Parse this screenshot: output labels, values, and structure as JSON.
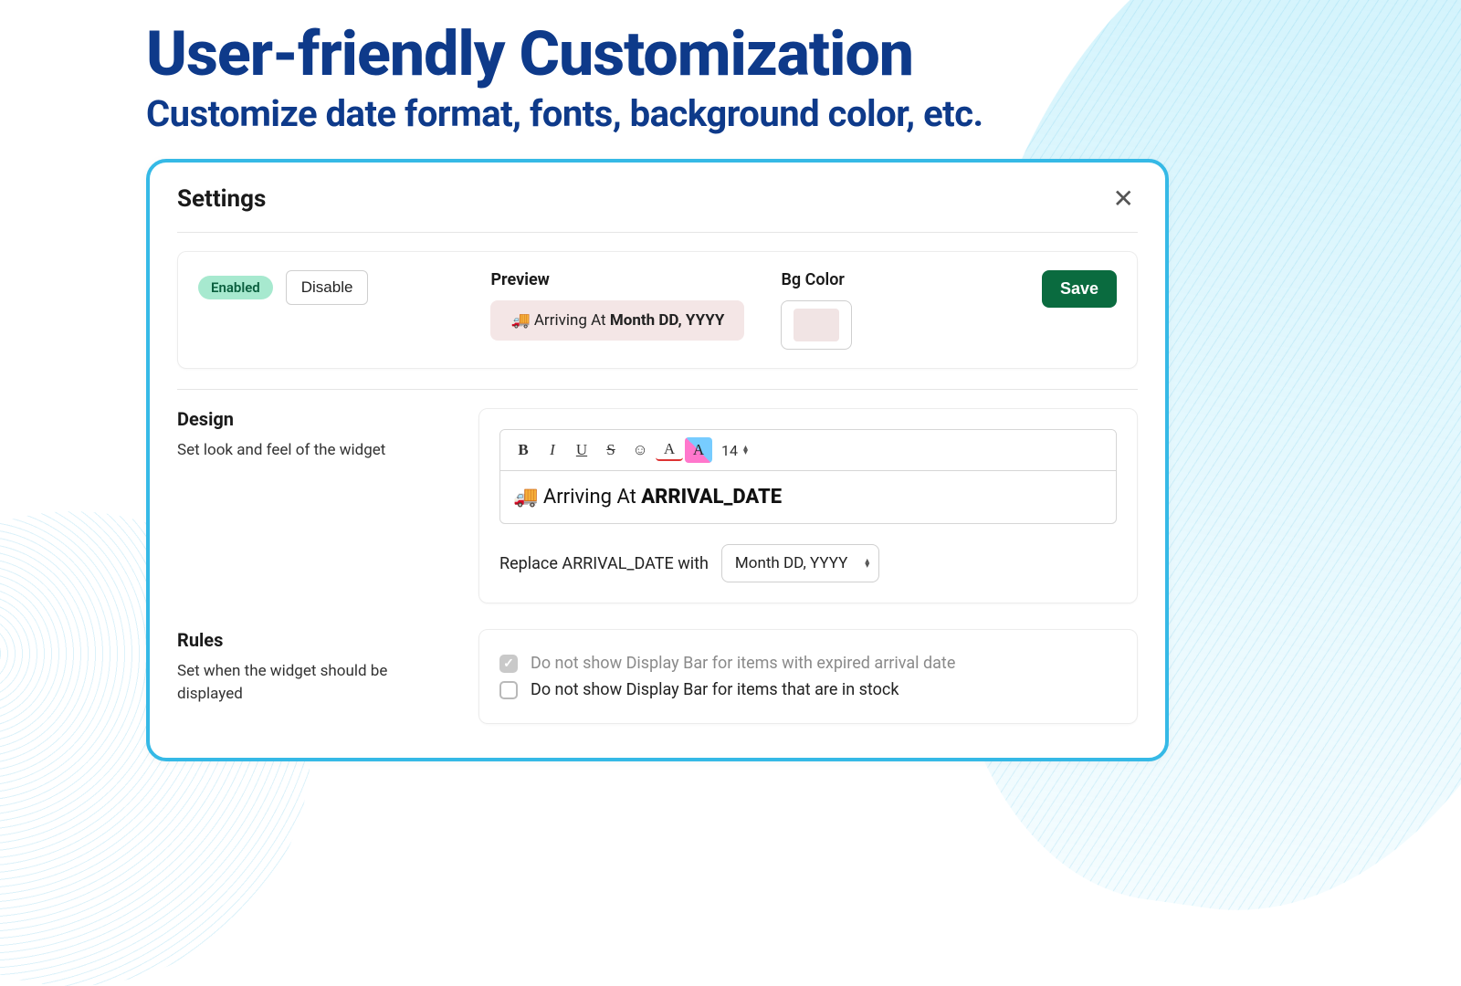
{
  "hero": {
    "title": "User-friendly Customization",
    "subtitle": "Customize date format, fonts, background color, etc."
  },
  "modal": {
    "title": "Settings",
    "close_icon": "✕"
  },
  "status": {
    "enabled_badge": "Enabled",
    "disable_button": "Disable"
  },
  "preview": {
    "label": "Preview",
    "truck_icon": "🚚",
    "prefix": "Arriving At ",
    "date_sample": "Month DD, YYYY"
  },
  "bgcolor": {
    "label": "Bg Color",
    "value": "#f1e4e4"
  },
  "save": {
    "label": "Save"
  },
  "design": {
    "heading": "Design",
    "description": "Set look and feel of the widget",
    "toolbar": {
      "bold": "B",
      "italic": "I",
      "underline": "U",
      "strike": "S",
      "emoji": "☺",
      "textcolor": "A",
      "highlight": "A",
      "fontsize": "14"
    },
    "editor_truck": "🚚",
    "editor_prefix": "Arriving At ",
    "editor_token": "ARRIVAL_DATE",
    "replace_label": "Replace ARRIVAL_DATE with",
    "replace_value": "Month DD, YYYY"
  },
  "rules": {
    "heading": "Rules",
    "description": "Set when the widget should be displayed",
    "rule1": "Do not show Display Bar for items with expired arrival date",
    "rule1_checked": true,
    "rule2": "Do not show Display Bar for items that are in stock",
    "rule2_checked": false
  }
}
